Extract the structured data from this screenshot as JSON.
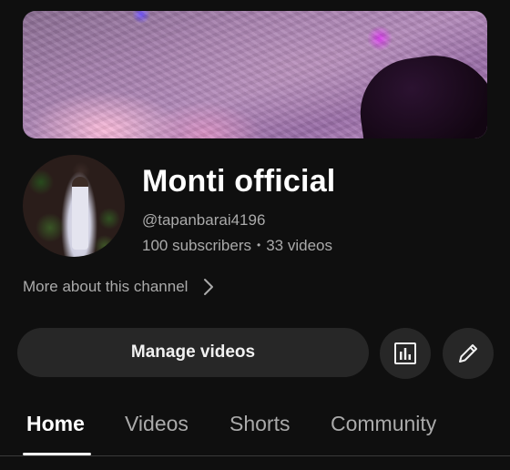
{
  "channel": {
    "name": "Monti official",
    "handle": "@tapanbarai4196",
    "subscribers": "100 subscribers",
    "separator": "•",
    "videos": "33 videos",
    "more_about": "More about this channel"
  },
  "actions": {
    "manage_videos_label": "Manage videos",
    "analytics_icon": "analytics-icon",
    "edit_icon": "pencil-icon"
  },
  "tabs": [
    {
      "label": "Home",
      "active": true
    },
    {
      "label": "Videos",
      "active": false
    },
    {
      "label": "Shorts",
      "active": false
    },
    {
      "label": "Community",
      "active": false
    }
  ],
  "colors": {
    "background": "#0f0f0f",
    "button_background": "#272727",
    "primary_text": "#ffffff",
    "secondary_text": "#aaaaaa"
  }
}
